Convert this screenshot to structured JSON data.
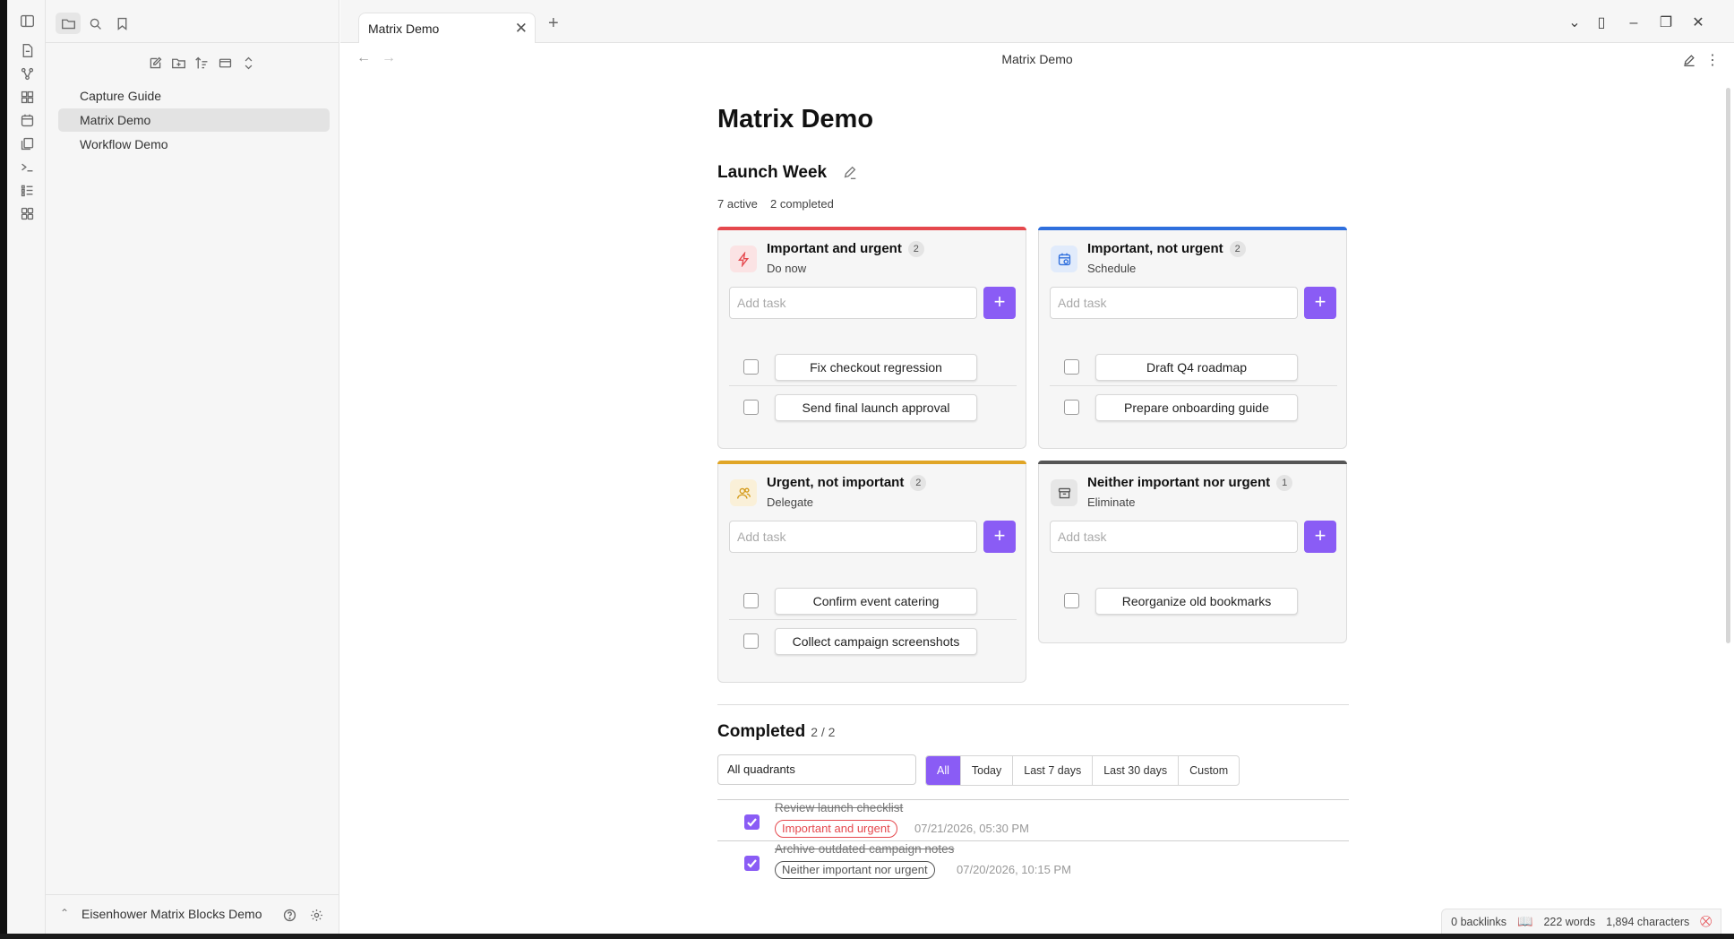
{
  "tab": {
    "title": "Matrix Demo"
  },
  "view": {
    "title": "Matrix Demo"
  },
  "sidebar": {
    "files": [
      "Capture Guide",
      "Matrix Demo",
      "Workflow Demo"
    ],
    "vault_name": "Eisenhower Matrix Blocks Demo"
  },
  "doc": {
    "title": "Matrix Demo",
    "board_title": "Launch Week",
    "active_count": "7 active",
    "completed_count": "2 completed"
  },
  "quadrants": [
    {
      "title": "Important and urgent",
      "count": "2",
      "subtitle": "Do now",
      "placeholder": "Add task",
      "add_label": "+",
      "accent": "#e5484d",
      "icon_bg": "#fbe3e4",
      "icon": "lightning-icon",
      "tasks": [
        "Fix checkout regression",
        "Send final launch approval"
      ]
    },
    {
      "title": "Important, not urgent",
      "count": "2",
      "subtitle": "Schedule",
      "placeholder": "Add task",
      "add_label": "+",
      "accent": "#2f6fdd",
      "icon_bg": "#e1ebfb",
      "icon": "calendar-clock-icon",
      "tasks": [
        "Draft Q4 roadmap",
        "Prepare onboarding guide"
      ]
    },
    {
      "title": "Urgent, not important",
      "count": "2",
      "subtitle": "Delegate",
      "placeholder": "Add task",
      "add_label": "+",
      "accent": "#e0a526",
      "icon_bg": "#faf0d8",
      "icon": "users-icon",
      "tasks": [
        "Confirm event catering",
        "Collect campaign screenshots"
      ]
    },
    {
      "title": "Neither important nor urgent",
      "count": "1",
      "subtitle": "Eliminate",
      "placeholder": "Add task",
      "add_label": "+",
      "accent": "#555555",
      "icon_bg": "#e6e6e6",
      "icon": "archive-icon",
      "tasks": [
        "Reorganize old bookmarks"
      ]
    }
  ],
  "completed": {
    "title": "Completed",
    "count": "2 / 2",
    "select_value": "All quadrants",
    "filters": [
      "All",
      "Today",
      "Last 7 days",
      "Last 30 days",
      "Custom"
    ],
    "active_filter": "All",
    "items": [
      {
        "text": "Review launch checklist",
        "tag": "Important and urgent",
        "tag_color": "#e5484d",
        "date": "07/21/2026, 05:30 PM"
      },
      {
        "text": "Archive outdated campaign notes",
        "tag": "Neither important nor urgent",
        "tag_color": "#555555",
        "date": "07/20/2026, 10:15 PM"
      }
    ]
  },
  "statusbar": {
    "backlinks": "0 backlinks",
    "words": "222 words",
    "characters": "1,894 characters"
  },
  "colors": {
    "accent": "#8a5cf5"
  }
}
